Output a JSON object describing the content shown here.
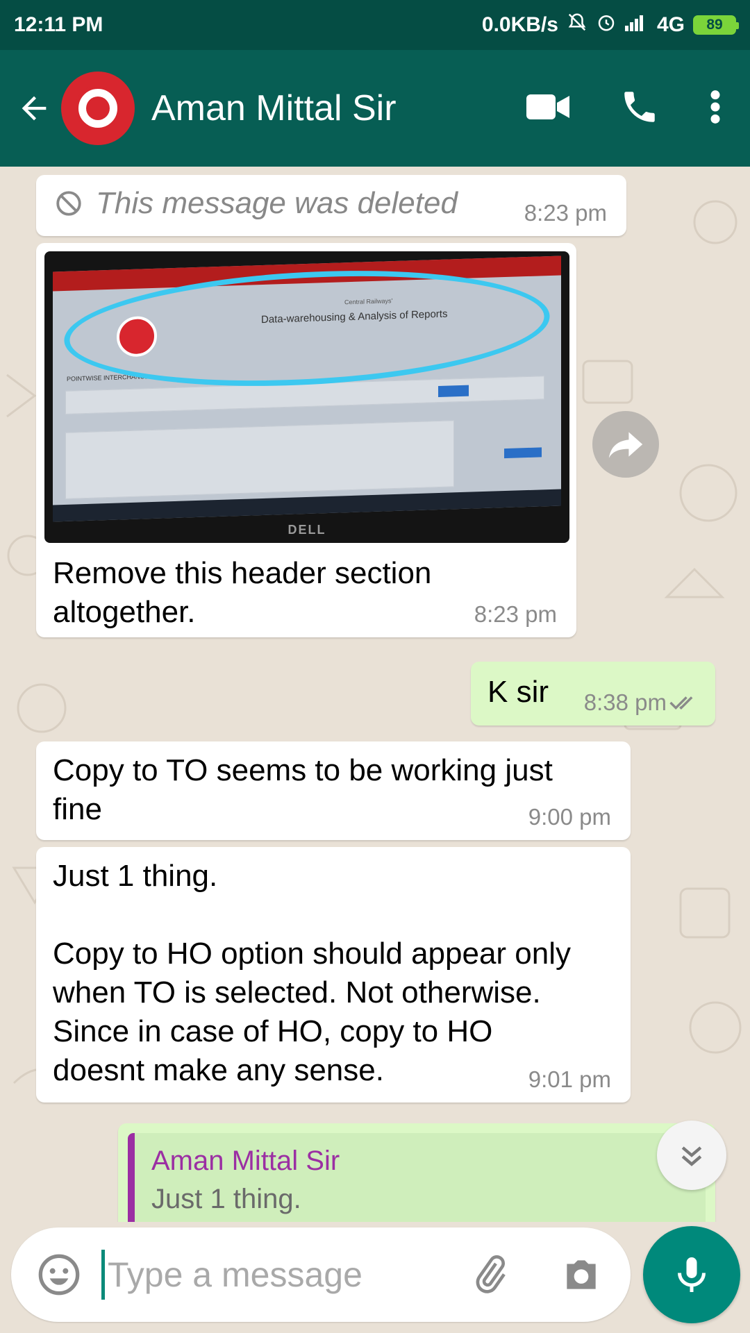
{
  "status_bar": {
    "time": "12:11 PM",
    "net_speed": "0.0KB/s",
    "network": "4G",
    "battery": "89"
  },
  "header": {
    "contact_name": "Aman Mittal Sir",
    "icons": [
      "back-arrow-icon",
      "video-call-icon",
      "voice-call-icon",
      "more-options-icon"
    ]
  },
  "messages": [
    {
      "direction": "incoming",
      "type": "deleted",
      "text": "This message was deleted",
      "time": "8:23 pm"
    },
    {
      "direction": "incoming",
      "type": "image",
      "caption": "Remove this header section\naltogether.",
      "time": "8:23 pm",
      "image_text": {
        "subtitle": "Central Railways'",
        "title": "Data-warehousing & Analysis of Reports",
        "section": "POINTWISE INTERCHANGE",
        "brand": "DELL"
      }
    },
    {
      "direction": "outgoing",
      "type": "text",
      "text": "K sir",
      "time": "8:38 pm",
      "status": "read"
    },
    {
      "direction": "incoming",
      "type": "text",
      "text": "Copy to TO seems to be working just\nfine",
      "time": "9:00 pm"
    },
    {
      "direction": "incoming",
      "type": "text",
      "text": "Just 1 thing.\n\nCopy to HO option should appear only\nwhen TO is selected. Not otherwise.\nSince in case of HO, copy to HO\ndoesnt make any sense.",
      "time": "9:01 pm"
    },
    {
      "direction": "outgoing",
      "type": "reply",
      "quote_author": "Aman Mittal Sir",
      "quote_text": "Just 1 thing."
    }
  ],
  "composer": {
    "placeholder": "Type a message"
  },
  "colors": {
    "header": "#075e54",
    "status_bar": "#054d44",
    "outgoing_bubble": "#dcf8c6",
    "incoming_bubble": "#ffffff",
    "chat_background": "#e9e1d6",
    "fab": "#00897b",
    "quote_accent": "#9b2fa3"
  }
}
